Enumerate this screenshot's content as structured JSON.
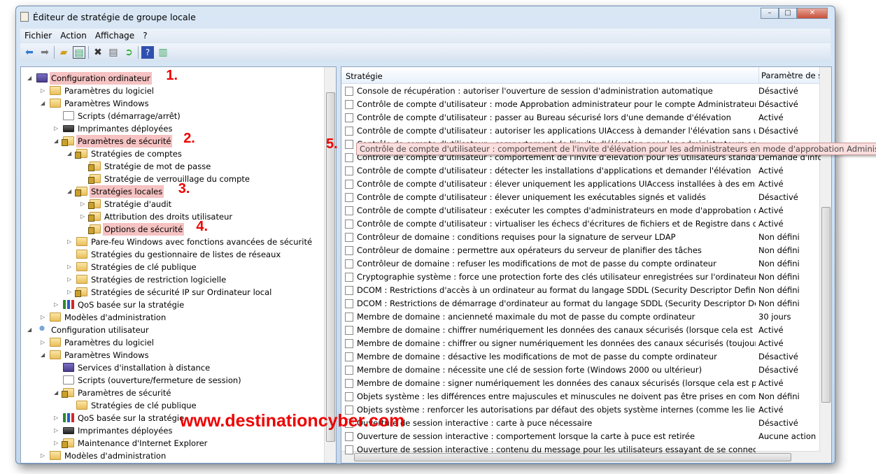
{
  "window": {
    "title": "Éditeur de stratégie de groupe locale",
    "controls": [
      "minimize",
      "maximize",
      "close"
    ]
  },
  "menu": [
    "Fichier",
    "Action",
    "Affichage",
    "?"
  ],
  "toolbar": [
    "back-icon",
    "forward-icon",
    "up-folder-icon",
    "show-hide-tree-icon",
    "delete-icon",
    "properties-icon",
    "export-icon",
    "help-icon",
    "show-action-pane-icon"
  ],
  "tree": [
    {
      "label": "Configuration ordinateur",
      "level": 0,
      "icon": "pc",
      "exp": "open",
      "hl": true,
      "ann": "1."
    },
    {
      "label": "Paramètres du logiciel",
      "level": 1,
      "icon": "folder",
      "exp": "closed"
    },
    {
      "label": "Paramètres Windows",
      "level": 1,
      "icon": "folder",
      "exp": "open"
    },
    {
      "label": "Scripts (démarrage/arrêt)",
      "level": 2,
      "icon": "doc"
    },
    {
      "label": "Imprimantes déployées",
      "level": 2,
      "icon": "print",
      "exp": "closed"
    },
    {
      "label": "Paramètres de sécurité",
      "level": 2,
      "icon": "sec",
      "exp": "open",
      "hl": true,
      "ann": "2."
    },
    {
      "label": "Stratégies de comptes",
      "level": 3,
      "icon": "sec",
      "exp": "open"
    },
    {
      "label": "Stratégie de mot de passe",
      "level": 4,
      "icon": "sec"
    },
    {
      "label": "Stratégie de verrouillage du compte",
      "level": 4,
      "icon": "sec"
    },
    {
      "label": "Stratégies locales",
      "level": 3,
      "icon": "sec",
      "exp": "open",
      "hl": true,
      "ann": "3."
    },
    {
      "label": "Stratégie d'audit",
      "level": 4,
      "icon": "sec",
      "exp": "closed"
    },
    {
      "label": "Attribution des droits utilisateur",
      "level": 4,
      "icon": "sec",
      "exp": "closed"
    },
    {
      "label": "Options de sécurité",
      "level": 4,
      "icon": "sec",
      "hl": true,
      "ann": "4."
    },
    {
      "label": "Pare-feu Windows avec fonctions avancées de sécurité",
      "level": 3,
      "icon": "folder",
      "exp": "closed"
    },
    {
      "label": "Stratégies du gestionnaire de listes de réseaux",
      "level": 3,
      "icon": "folder"
    },
    {
      "label": "Stratégies de clé publique",
      "level": 3,
      "icon": "folder",
      "exp": "closed"
    },
    {
      "label": "Stratégies de restriction logicielle",
      "level": 3,
      "icon": "folder",
      "exp": "closed"
    },
    {
      "label": "Stratégies de sécurité IP sur Ordinateur local",
      "level": 3,
      "icon": "sec",
      "exp": "closed"
    },
    {
      "label": "QoS basée sur la stratégie",
      "level": 2,
      "icon": "chart",
      "exp": "closed"
    },
    {
      "label": "Modèles d'administration",
      "level": 1,
      "icon": "folder",
      "exp": "closed"
    },
    {
      "label": "Configuration utilisateur",
      "level": 0,
      "icon": "user",
      "exp": "open"
    },
    {
      "label": "Paramètres du logiciel",
      "level": 1,
      "icon": "folder",
      "exp": "closed"
    },
    {
      "label": "Paramètres Windows",
      "level": 1,
      "icon": "folder",
      "exp": "open"
    },
    {
      "label": "Services d'installation à distance",
      "level": 2,
      "icon": "pc"
    },
    {
      "label": "Scripts (ouverture/fermeture de session)",
      "level": 2,
      "icon": "doc"
    },
    {
      "label": "Paramètres de sécurité",
      "level": 2,
      "icon": "sec",
      "exp": "open"
    },
    {
      "label": "Stratégies de clé publique",
      "level": 3,
      "icon": "folder"
    },
    {
      "label": "QoS basée sur la stratégie",
      "level": 2,
      "icon": "chart",
      "exp": "closed"
    },
    {
      "label": "Imprimantes déployées",
      "level": 2,
      "icon": "print",
      "exp": "closed"
    },
    {
      "label": "Maintenance d'Internet Explorer",
      "level": 2,
      "icon": "sec",
      "exp": "closed"
    },
    {
      "label": "Modèles d'administration",
      "level": 1,
      "icon": "folder",
      "exp": "closed"
    }
  ],
  "list": {
    "columns": [
      "Stratégie",
      "Paramètre de sé"
    ],
    "rows": [
      [
        "Console de récupération : autoriser l'ouverture de session d'administration automatique",
        "Désactivé"
      ],
      [
        "Contrôle de compte d'utilisateur : mode Approbation administrateur pour le compte Administrateur inté...",
        "Désactivé"
      ],
      [
        "Contrôle de compte d'utilisateur : passer au Bureau sécurisé lors d'une demande d'élévation",
        "Activé"
      ],
      [
        "Contrôle de compte d'utilisateur : autoriser les applications UIAccess à demander l'élévation sans utiliser l...",
        "Désactivé"
      ],
      [
        "Contrôle de compte d'utilisateur : comportement de l'invite d'élévation pour les administrateurs en mode d'approbation Administrateur",
        ""
      ],
      [
        "Contrôle de compte d'utilisateur : comportement de l'invite d'élévation pour les utilisateurs standard",
        "Demande d'info"
      ],
      [
        "Contrôle de compte d'utilisateur : détecter les installations d'applications et demander l'élévation",
        "Activé"
      ],
      [
        "Contrôle de compte d'utilisateur : élever uniquement les applications UIAccess installées à des emplacem...",
        "Activé"
      ],
      [
        "Contrôle de compte d'utilisateur : élever uniquement les exécutables signés et validés",
        "Désactivé"
      ],
      [
        "Contrôle de compte d'utilisateur : exécuter les comptes d'administrateurs en mode d'approbation d'admi...",
        "Activé"
      ],
      [
        "Contrôle de compte d'utilisateur : virtualiser les échecs d'écritures de fichiers et de Registre dans des empl...",
        "Activé"
      ],
      [
        "Contrôleur de domaine : conditions requises pour la signature de serveur LDAP",
        "Non défini"
      ],
      [
        "Contrôleur de domaine : permettre aux opérateurs du serveur de planifier des tâches",
        "Non défini"
      ],
      [
        "Contrôleur de domaine : refuser les modifications de mot de passe du compte ordinateur",
        "Non défini"
      ],
      [
        "Cryptographie système : force une protection forte des clés utilisateur enregistrées sur l'ordinateur",
        "Non défini"
      ],
      [
        "DCOM : Restrictions d'accès à un ordinateur au format du langage SDDL (Security Descriptor Definition La...",
        "Non défini"
      ],
      [
        "DCOM : Restrictions de démarrage d'ordinateur au format du langage SDDL (Security Descriptor Definitio...",
        "Non défini"
      ],
      [
        "Membre de domaine : ancienneté maximale du mot de passe du compte ordinateur",
        "30 jours"
      ],
      [
        "Membre de domaine : chiffrer numériquement les données des canaux sécurisés (lorsque cela est possible)",
        "Activé"
      ],
      [
        "Membre de domaine : chiffrer ou signer numériquement les données des canaux sécurisés (toujours)",
        "Activé"
      ],
      [
        "Membre de domaine : désactive les modifications de mot de passe du compte ordinateur",
        "Désactivé"
      ],
      [
        "Membre de domaine : nécessite une clé de session forte (Windows 2000 ou ultérieur)",
        "Désactivé"
      ],
      [
        "Membre de domaine : signer numériquement les données des canaux sécurisés (lorsque cela est possible)",
        "Activé"
      ],
      [
        "Objets système : les différences entre majuscules et minuscules ne doivent pas être prises en compte pour...",
        "Non défini"
      ],
      [
        "Objets système : renforcer les autorisations par défaut des objets système internes (comme les liens de sy...",
        "Activé"
      ],
      [
        "Ouverture de session interactive : carte à puce nécessaire",
        "Désactivé"
      ],
      [
        "Ouverture de session interactive : comportement lorsque la carte à puce est retirée",
        "Aucune action"
      ],
      [
        "Ouverture de session interactive : contenu du message pour les utilisateurs essayant de se connecter",
        ""
      ]
    ],
    "tooltip": "Contrôle de compte d'utilisateur : comportement de l'invite d'élévation pour les administrateurs en mode d'approbation Administrateur"
  },
  "annotations": {
    "step5": "5."
  },
  "watermark": "www.destinationcyber.com",
  "colors": {
    "highlight": "#f6c2c2",
    "annotation": "#ee0000"
  }
}
